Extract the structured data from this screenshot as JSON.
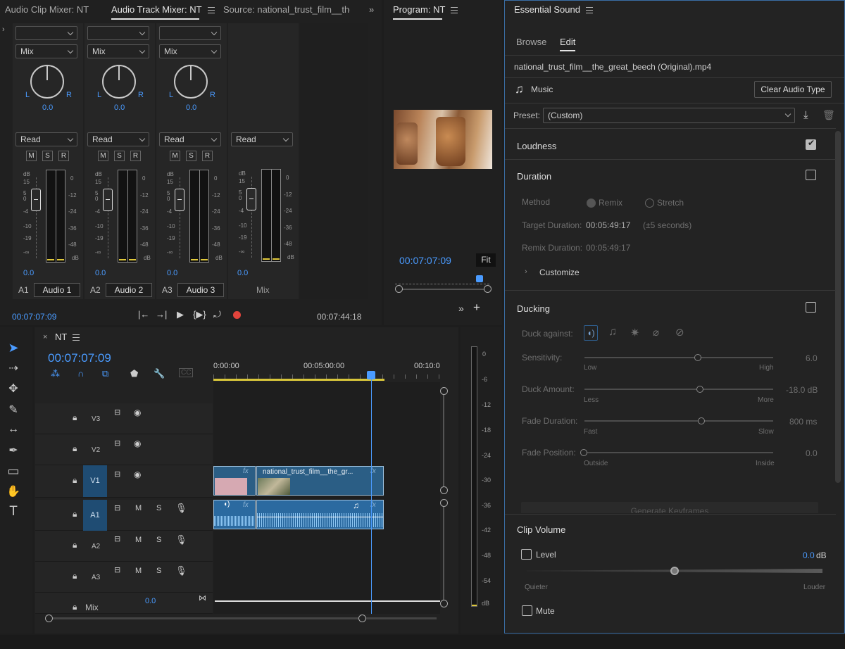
{
  "mixer_tabs": {
    "clip_mixer": "Audio Clip Mixer: NT",
    "track_mixer": "Audio Track Mixer: NT",
    "source": "Source: national_trust_film__the_"
  },
  "mixer": {
    "channels": [
      {
        "mode": "Mix",
        "pan": "0.0",
        "automation": "Read",
        "volume": "0.0",
        "id": "A1",
        "name": "Audio 1"
      },
      {
        "mode": "Mix",
        "pan": "0.0",
        "automation": "Read",
        "volume": "0.0",
        "id": "A2",
        "name": "Audio 2"
      },
      {
        "mode": "Mix",
        "pan": "0.0",
        "automation": "Read",
        "volume": "0.0",
        "id": "A3",
        "name": "Audio 3"
      }
    ],
    "master": {
      "automation": "Read",
      "volume": "0.0",
      "name": "Mix"
    },
    "pan_l": "L",
    "pan_r": "R",
    "btn_m": "M",
    "btn_s": "S",
    "btn_r": "R",
    "fader_scale": [
      "dB",
      "15",
      "5",
      "0",
      "-4",
      "-10",
      "-19",
      "-∞"
    ],
    "meter_scale": [
      "0",
      "-12",
      "-24",
      "-36",
      "-48",
      "dB"
    ],
    "timecode_left": "00:07:07:09",
    "timecode_right": "00:07:44:18"
  },
  "program": {
    "title": "Program: NT",
    "timecode": "00:07:07:09",
    "fit": "Fit"
  },
  "essential_sound": {
    "title": "Essential Sound",
    "tabs": [
      "Browse",
      "Edit"
    ],
    "filename": "national_trust_film__the_great_beech (Original).mp4",
    "type": "Music",
    "clear_button": "Clear Audio Type",
    "preset_label": "Preset:",
    "preset_value": "(Custom)",
    "loudness": "Loudness",
    "duration": "Duration",
    "method_label": "Method",
    "remix": "Remix",
    "stretch": "Stretch",
    "target_label": "Target Duration:",
    "target_value": "00:05:49:17",
    "target_note": "(±5 seconds)",
    "remix_label": "Remix Duration:",
    "remix_value": "00:05:49:17",
    "customize": "Customize",
    "ducking": "Ducking",
    "duck_against": "Duck against:",
    "sensitivity": {
      "label": "Sensitivity:",
      "low": "Low",
      "high": "High",
      "value": "6.0"
    },
    "duck_amount": {
      "label": "Duck Amount:",
      "low": "Less",
      "high": "More",
      "value": "-18.0 dB"
    },
    "fade_duration": {
      "label": "Fade Duration:",
      "low": "Fast",
      "high": "Slow",
      "value": "800 ms"
    },
    "fade_position": {
      "label": "Fade Position:",
      "low": "Outside",
      "high": "Inside",
      "value": "0.0"
    },
    "generate": "Generate Keyframes",
    "clip_volume": "Clip Volume",
    "level": "Level",
    "level_value": "0.0",
    "level_unit": "dB",
    "quieter": "Quieter",
    "louder": "Louder",
    "mute": "Mute"
  },
  "timeline": {
    "sequence": "NT",
    "timecode": "00:07:07:09",
    "ruler": [
      "0:00:00",
      "00:05:00:00",
      "00:10:0"
    ],
    "tracks": {
      "v3": "V3",
      "v2": "V2",
      "v1": "V1",
      "a1": "A1",
      "a2": "A2",
      "a3": "A3",
      "m": "M",
      "s": "S",
      "mix": "Mix",
      "mix_value": "0.0"
    },
    "clip_name": "national_trust_film__the_gr...",
    "fx": "fx",
    "meter_scale": [
      "0",
      "-6",
      "-12",
      "-18",
      "-24",
      "-30",
      "-36",
      "-42",
      "-48",
      "-54",
      "dB"
    ]
  }
}
